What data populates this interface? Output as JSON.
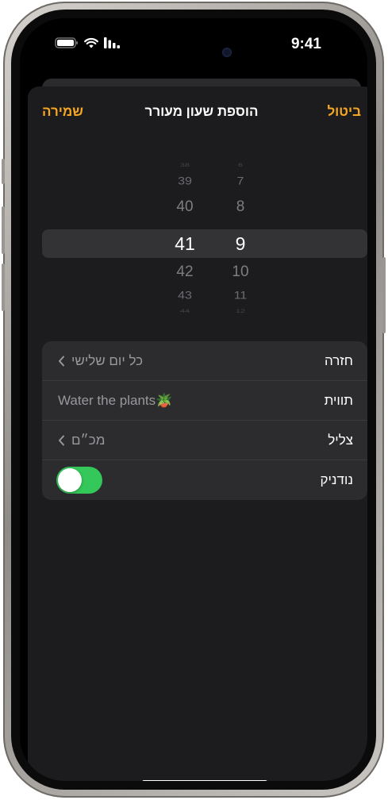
{
  "status": {
    "time": "9:41"
  },
  "nav": {
    "save": "שמירה",
    "title": "הוספת שעון מעורר",
    "cancel": "ביטול"
  },
  "picker": {
    "minutes": [
      "38",
      "39",
      "40",
      "41",
      "42",
      "43",
      "44"
    ],
    "hours": [
      "6",
      "7",
      "8",
      "9",
      "10",
      "11",
      "12"
    ],
    "selected_minute": "41",
    "selected_hour": "9"
  },
  "settings": {
    "repeat": {
      "label": "חזרה",
      "value": "כל יום שלישי"
    },
    "label": {
      "label": "תווית",
      "value": "Water the plants🪴"
    },
    "sound": {
      "label": "צליל",
      "value": "מכ״ם"
    },
    "snooze": {
      "label": "נודניק",
      "enabled": true
    }
  },
  "colors": {
    "accent": "#f5a623",
    "toggle_on": "#34c759",
    "sheet": "#1c1c1e",
    "cell": "#2c2c2e"
  }
}
